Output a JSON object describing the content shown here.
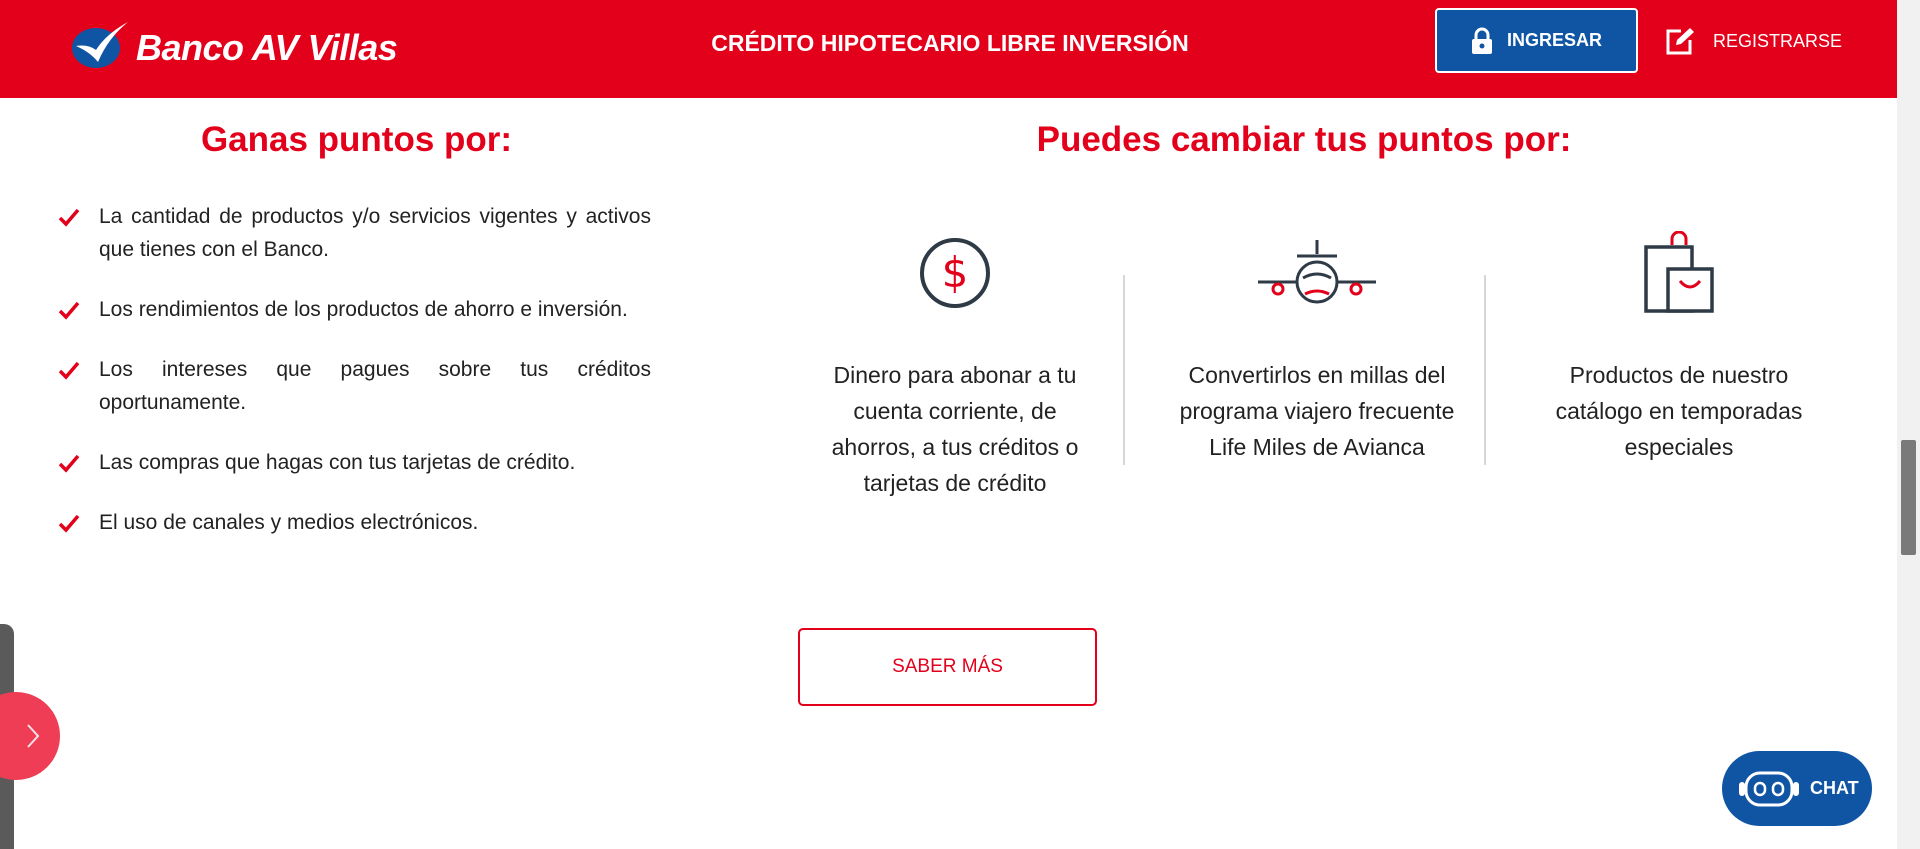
{
  "header": {
    "brand": "Banco AV Villas",
    "title": "CRÉDITO HIPOTECARIO LIBRE INVERSIÓN",
    "login_label": "INGRESAR",
    "register_label": "REGISTRARSE"
  },
  "left": {
    "heading": "Ganas puntos por:",
    "items": [
      "La cantidad de productos y/o servicios vigentes y activos que tienes con el Banco.",
      "Los rendimientos de los productos de ahorro e inversión.",
      "Los intereses que pagues sobre tus créditos oportunamente.",
      "Las compras que hagas con tus tarjetas de crédito.",
      "El uso de canales y medios electrónicos."
    ]
  },
  "right": {
    "heading": "Puedes cambiar tus puntos por:",
    "options": [
      {
        "icon": "dollar-coin-icon",
        "text": "Dinero para abonar a tu cuenta corriente, de ahorros, a tus créditos o tarjetas de crédito"
      },
      {
        "icon": "airplane-icon",
        "text": "Convertirlos en millas del programa viajero frecuente Life Miles de Avianca"
      },
      {
        "icon": "shopping-bag-icon",
        "text": "Productos de nuestro catálogo en temporadas especiales"
      }
    ]
  },
  "cta": {
    "more_label": "SABER MÁS"
  },
  "chat": {
    "label": "CHAT"
  },
  "colors": {
    "brand_red": "#e3001b",
    "brand_blue": "#1055a4",
    "side_toggle": "#ee3d55"
  }
}
